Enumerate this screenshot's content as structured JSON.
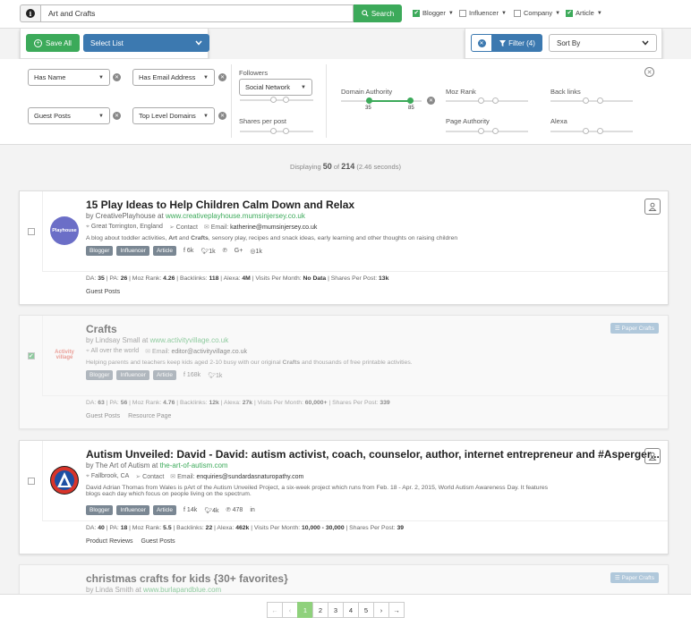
{
  "search": {
    "value": "Art and Crafts",
    "button": "Search"
  },
  "type_filters": [
    {
      "label": "Blogger",
      "checked": true
    },
    {
      "label": "Influencer",
      "checked": false
    },
    {
      "label": "Company",
      "checked": false
    },
    {
      "label": "Article",
      "checked": true
    }
  ],
  "toolbar": {
    "save_all": "Save All",
    "select_list": "Select List",
    "filter": "Filter (4)",
    "sort_by": "Sort By"
  },
  "filters": {
    "has_name": "Has Name",
    "has_email": "Has Email Address",
    "guest_posts": "Guest Posts",
    "top_level_domains": "Top Level Domains",
    "followers": "Followers",
    "social_network": "Social Network",
    "shares_per_post": "Shares per post",
    "domain_authority": "Domain Authority",
    "da_min": "35",
    "da_max": "85",
    "moz_rank": "Moz Rank",
    "back_links": "Back links",
    "page_authority": "Page Authority",
    "alexa": "Alexa"
  },
  "results": {
    "prefix": "Displaying",
    "shown": "50",
    "of": "of",
    "total": "214",
    "time": "(2.46 seconds)"
  },
  "cards": [
    {
      "title": "15 Play Ideas to Help Children Calm Down and Relax",
      "by": "by CreativePlayhouse at",
      "site": "www.creativeplayhouse.mumsinjersey.co.uk",
      "location": "Great Torrington, England",
      "contact": "Contact",
      "email_label": "Email:",
      "email": "katherine@mumsinjersey.co.uk",
      "desc_1": "A blog about toddler activities, ",
      "desc_b1": "Art",
      "desc_2": " and ",
      "desc_b2": "Crafts",
      "desc_3": ", sensory play, recipes and snack ideas, early learning and other thoughts on raising children",
      "tags": [
        "Blogger",
        "Influencer",
        "Article"
      ],
      "fb": "6k",
      "tw": "1k",
      "ig": "1k",
      "avatar_text": "Playhouse",
      "stats": {
        "da": "35",
        "pa": "26",
        "moz": "4.26",
        "backlinks": "118",
        "alexa": "4M",
        "visits": "No Data",
        "shares": "13k"
      },
      "links": [
        "Guest Posts"
      ]
    },
    {
      "title": "Crafts",
      "by": "by Lindsay Small at",
      "site": "www.activityvillage.co.uk",
      "location": "All over the world",
      "email_label": "Email:",
      "email": "editor@activityvillage.co.uk",
      "desc_1": "Helping parents and teachers keep kids aged 2-10 busy with our original ",
      "desc_b1": "Crafts",
      "desc_2": " and thousands of free printable activities.",
      "tags": [
        "Blogger",
        "Influencer",
        "Article"
      ],
      "fb": "168k",
      "tw": "1k",
      "avatar_text": "Activity village",
      "badge": "Paper Crafts",
      "stats": {
        "da": "63",
        "pa": "56",
        "moz": "4.76",
        "backlinks": "12k",
        "alexa": "27k",
        "visits": "60,000+",
        "shares": "339"
      },
      "links": [
        "Guest Posts",
        "Resource Page"
      ]
    },
    {
      "title": "Autism Unveiled: David - David: autism activist, coach, counselor, author, internet entrepreneur and #Asperger...",
      "by": "by The Art of Autism at",
      "site": "the-art-of-autism.com",
      "location": "Fallbrook, CA",
      "contact": "Contact",
      "email_label": "Email:",
      "email": "enquiries@sundardasnaturopathy.com",
      "desc_1": "David Adrian Thomas from Wales is pArt of the Autism Unveiled Project, a six-week project which runs from Feb. 18 - Apr. 2, 2015, World Autism Awareness Day. It features",
      "desc_line2": "blogs each day which focus on people living on the spectrum.",
      "tags": [
        "Blogger",
        "Influencer",
        "Article"
      ],
      "fb": "14k",
      "tw": "4k",
      "pin": "478",
      "stats": {
        "da": "40",
        "pa": "18",
        "moz": "5.5",
        "backlinks": "22",
        "alexa": "462k",
        "visits": "10,000 - 30,000",
        "shares": "39"
      },
      "links": [
        "Product Reviews",
        "Guest Posts"
      ]
    },
    {
      "title": "christmas crafts for kids {30+ favorites}",
      "by": "by Linda Smith at",
      "site": "www.burlapandblue.com",
      "badge": "Paper Crafts"
    }
  ],
  "stat_labels": {
    "da": "DA:",
    "pa": "PA:",
    "moz": "Moz Rank:",
    "backlinks": "Backlinks:",
    "alexa": "Alexa:",
    "visits": "Visits Per Month:",
    "shares": "Shares Per Post:"
  },
  "pagination": {
    "pages": [
      "1",
      "2",
      "3",
      "4",
      "5"
    ],
    "prev": "‹",
    "first": "←",
    "next": "›",
    "last": "→",
    "current": "1"
  }
}
